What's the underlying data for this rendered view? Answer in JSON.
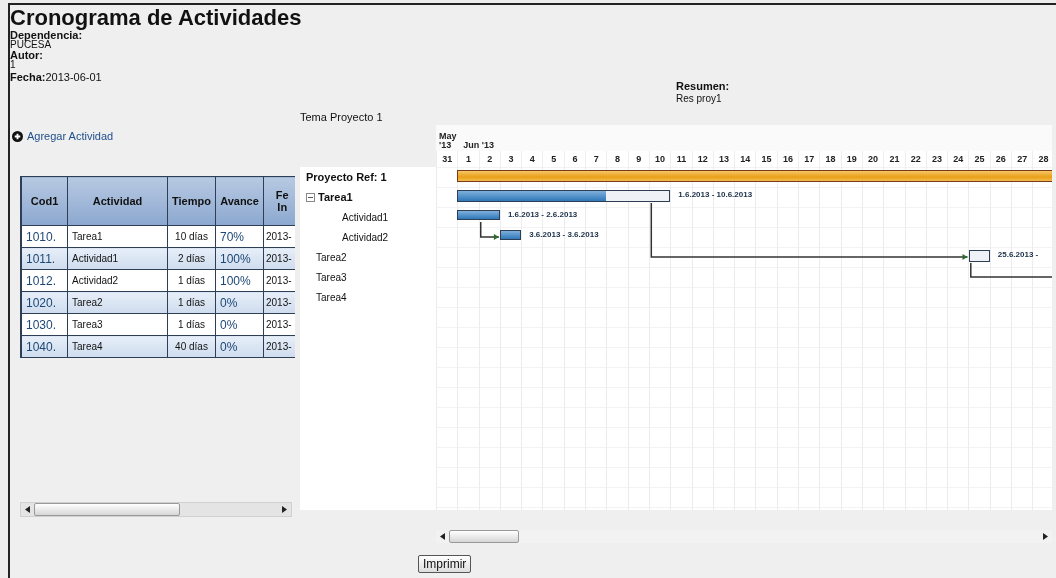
{
  "title": "Cronograma de Actividades",
  "details": [
    {
      "label": "Dependencia:",
      "value": "PUCESA"
    },
    {
      "label": "Autor:",
      "value": "1"
    }
  ],
  "date": {
    "label": "Fecha:",
    "value": "2013-06-01"
  },
  "summary": {
    "label": "Resumen:",
    "value": "Res proy1"
  },
  "theme": "Tema Proyecto 1",
  "add_action": {
    "label": "Agregar Actividad"
  },
  "table": {
    "columns": [
      "Cod1",
      "Actividad",
      "Tiempo",
      "Avance",
      "Fe In"
    ],
    "rows": [
      {
        "cells": [
          "1010.",
          "Tarea1",
          "10 días",
          "70%",
          "2013-"
        ]
      },
      {
        "cells": [
          "1011.",
          "Actividad1",
          "2 días",
          "100%",
          "2013-"
        ]
      },
      {
        "cells": [
          "1012.",
          "Actividad2",
          "1 días",
          "100%",
          "2013-"
        ]
      },
      {
        "cells": [
          "1020.",
          "Tarea2",
          "1 días",
          "0%",
          "2013-"
        ]
      },
      {
        "cells": [
          "1030.",
          "Tarea3",
          "1 días",
          "0%",
          "2013-"
        ]
      },
      {
        "cells": [
          "1040.",
          "Tarea4",
          "40 días",
          "0%",
          "2013-"
        ]
      }
    ]
  },
  "gantt": {
    "months": [
      {
        "label": "May '13",
        "days": [
          "31"
        ]
      },
      {
        "label": "Jun '13",
        "days": [
          "1",
          "2",
          "3",
          "4",
          "5",
          "6",
          "7",
          "8",
          "9",
          "10",
          "11",
          "12",
          "13",
          "14",
          "15",
          "16",
          "17",
          "18",
          "19",
          "20",
          "21",
          "22",
          "23",
          "24",
          "25",
          "26",
          "27",
          "28"
        ]
      }
    ],
    "project": {
      "label": "Proyecto Ref: 1"
    },
    "tasks": [
      {
        "name": "Tarea1",
        "expanded": true,
        "level": 0.7,
        "dates": "1.6.2013 - 10.6.2013",
        "children": [
          {
            "name": "Actividad1",
            "level": 1,
            "dates": "1.6.2013 - 2.6.2013"
          },
          {
            "name": "Actividad2",
            "level": 1,
            "dates": "3.6.2013 - 3.6.2013",
            "linked_to_previous": true
          }
        ]
      },
      {
        "name": "Tarea2",
        "level": 0,
        "dates": "25.6.2013 -",
        "linked_to_previous": true
      },
      {
        "name": "Tarea3",
        "linked_to_previous": true
      },
      {
        "name": "Tarea4"
      }
    ]
  },
  "print_button": "Imprimir"
}
